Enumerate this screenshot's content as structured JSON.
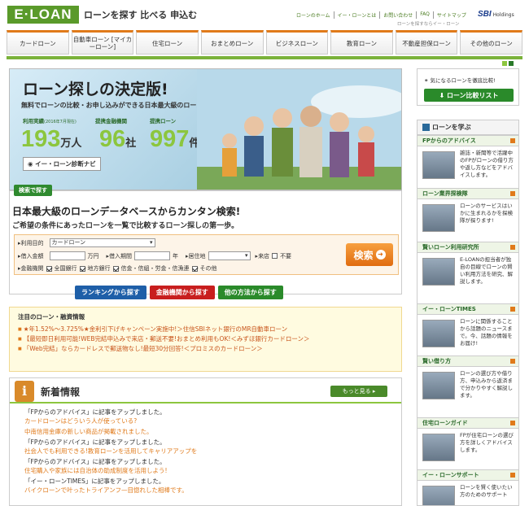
{
  "header": {
    "logo": "E·LOAN",
    "tagline": "ローンを探す 比べる 申込む",
    "top_links": [
      "ローンのホーム",
      "イー・ローンとは",
      "お問い合わせ",
      "FAQ",
      "サイトマップ"
    ],
    "sbi_mark": "SBI",
    "sbi_holdings": "Holdings",
    "sbi_sub": "ローンを探すならイー・ローン"
  },
  "nav": [
    "カードローン",
    "自動車ローン [マイカーローン]",
    "住宅ローン",
    "おまとめローン",
    "ビジネスローン",
    "教育ローン",
    "不動産担保ローン",
    "その他のローン"
  ],
  "hero": {
    "title": "ローン探しの決定版!",
    "subtitle": "無料でローンの比較・お申し込みができる日本最大級のローンデータベース",
    "stats": [
      {
        "label": "利用実績",
        "note": "(2016年7月現在)",
        "num": "193",
        "unit": "万人"
      },
      {
        "label": "提携金融機関",
        "num": "96",
        "unit": "社"
      },
      {
        "label": "提携ローン",
        "num": "997",
        "unit": "件"
      }
    ],
    "diag_link": "イー・ローン診断ナビ"
  },
  "search": {
    "tab": "検索で探す",
    "heading": "日本最大級のローンデータベースからカンタン検索!",
    "sub": "ご希望の条件にあったローンを一覧で比較するローン探しの第一歩。",
    "purpose_label": "利用目的",
    "purpose_value": "カードローン",
    "amount_label": "借入金額",
    "amount_unit": "万円",
    "period_label": "借入期間",
    "period_unit": "年",
    "area_label": "居住地",
    "visit_label": "来店",
    "visit_none": "不要",
    "inst_label": "金融機関",
    "inst_options": [
      "全国銀行",
      "地方銀行",
      "信金・信組・労金・信漁連",
      "その他"
    ],
    "button": "検索",
    "tabs": [
      {
        "label": "ランキングから探す",
        "color": "#1e5fa8"
      },
      {
        "label": "金融機関から探す",
        "color": "#c81e1e"
      },
      {
        "label": "他の方法から探す",
        "color": "#2a8a2a"
      }
    ]
  },
  "notice": {
    "title": "注目のローン・融資情報",
    "items": [
      "★年1.52%～3.725%★金利引下げキャンペーン実施中!＞住信SBIネット銀行のMR自動車ローン",
      "【最短即日利用可能!WEB完結申込みで来店・郵送不要!おまとめ利用もOK!＜みずほ銀行カードローン＞",
      "「Web完結」ならカードレスで郵送物なし!最短30分回答!＜プロミスのカードローン＞"
    ]
  },
  "news": {
    "title": "新着情報",
    "more": "もっと見る",
    "items": [
      {
        "l1": "「FPからのアドバイス」に記事をアップしました。",
        "l2": "カードローンはどういう人が使っている?"
      },
      {
        "l1": "",
        "l2": "中南信用金庫の新しい商品が掲載されました。"
      },
      {
        "l1": "「FPからのアドバイス」に記事をアップしました。",
        "l2": "社会人でも利用できる!教育ローンを活用してキャリアアップを"
      },
      {
        "l1": "「FPからのアドバイス」に記事をアップしました。",
        "l2": "住宅購入や家族には自治体の助成制度を活用しよう!"
      },
      {
        "l1": "「イー・ローンTIMES」に記事をアップしました。",
        "l2": "バイクローンで叶ったトライアンフ—目惚れした相棒です。"
      }
    ]
  },
  "side": {
    "banner_text": "気になるローンを徹底比較!",
    "banner_btn": "ローン比較リスト",
    "learn_title": "ローンを学ぶ",
    "sections": [
      {
        "title": "FPからのアドバイス",
        "body": "雑誌・新聞等で活躍中のFPがローンの借り方や返し方などをアドバイスします。"
      },
      {
        "title": "ローン業界探検隊",
        "body": "ローンのサービスはいかに生まれるかを探検隊が探ります!"
      },
      {
        "title": "賢いローン利用研究所",
        "body": "E-LOANの担当者が独自の目線でローンの賢い利用方法を研究、解説します。"
      },
      {
        "title": "イー・ローンTIMES",
        "body": "ローンに関係することから話題のニュースまで。今、話題の情報をお届け!"
      },
      {
        "title": "賢い借り方",
        "body": "ローンの選び方や借り方、申込みから返済まで分かりやすく解説します。"
      },
      {
        "title": "住宅ローンガイド",
        "body": "FPが住宅ローンの選び方を詳しくアドバイスします。"
      },
      {
        "title": "イー・ローンサポート",
        "body": "ローンを賢く使いたい方のためのサポート"
      }
    ]
  }
}
